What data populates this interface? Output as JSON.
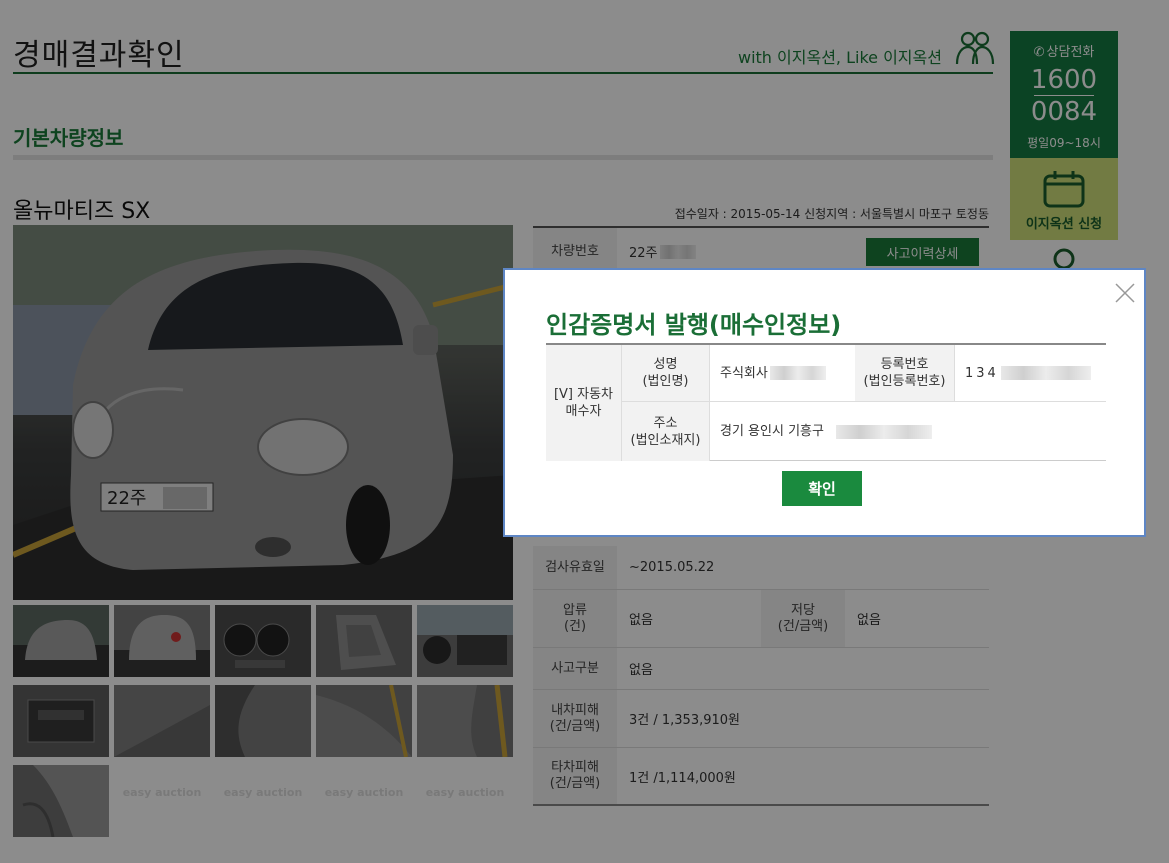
{
  "header": {
    "title": "경매결과확인",
    "tagline": "with 이지옥션, Like 이지옥션"
  },
  "section": {
    "title": "기본차량정보"
  },
  "car": {
    "name": "올뉴마티즈 SX",
    "reg_info": "접수일자 : 2015-05-14 신청지역 : 서울특별시 마포구 토정동",
    "plate_visible": "22주",
    "thumbnail_placeholder_logo": "easy auction"
  },
  "info": {
    "rows": [
      {
        "label": "차량번호",
        "value": "22주",
        "button": "사고이력상세"
      },
      {
        "label": "검사유효일",
        "value": "~2015.05.22"
      },
      {
        "label": "압류\n(건)",
        "value": "없음",
        "label2": "저당\n(건/금액)",
        "value2": "없음"
      },
      {
        "label": "사고구분",
        "value": "없음"
      },
      {
        "label": "내차피해\n(건/금액)",
        "value": "3건 / 1,353,910원"
      },
      {
        "label": "타차피해\n(건/금액)",
        "value": "1건 /1,114,000원"
      }
    ]
  },
  "sidebar": {
    "call_label": "상담전화",
    "phone_1": "1600",
    "phone_2": "0084",
    "hours": "평일09~18시",
    "apply_label": "이지옥션 신청"
  },
  "modal": {
    "title": "인감증명서 발행(매수인정보)",
    "buyer_type": "[V] 자동차\n매수자",
    "name_label": "성명\n(법인명)",
    "name_value": "주식회사",
    "regno_label": "등록번호\n(법인등록번호)",
    "regno_value": "134",
    "addr_label": "주소\n(법인소재지)",
    "addr_value": "경기 용인시 기흥구",
    "confirm_label": "확인"
  },
  "colors": {
    "brand_green": "#1a7a3a",
    "side_call_bg": "#157a43",
    "side_apply_bg": "#cfe07a",
    "modal_border": "#5e86c5"
  }
}
